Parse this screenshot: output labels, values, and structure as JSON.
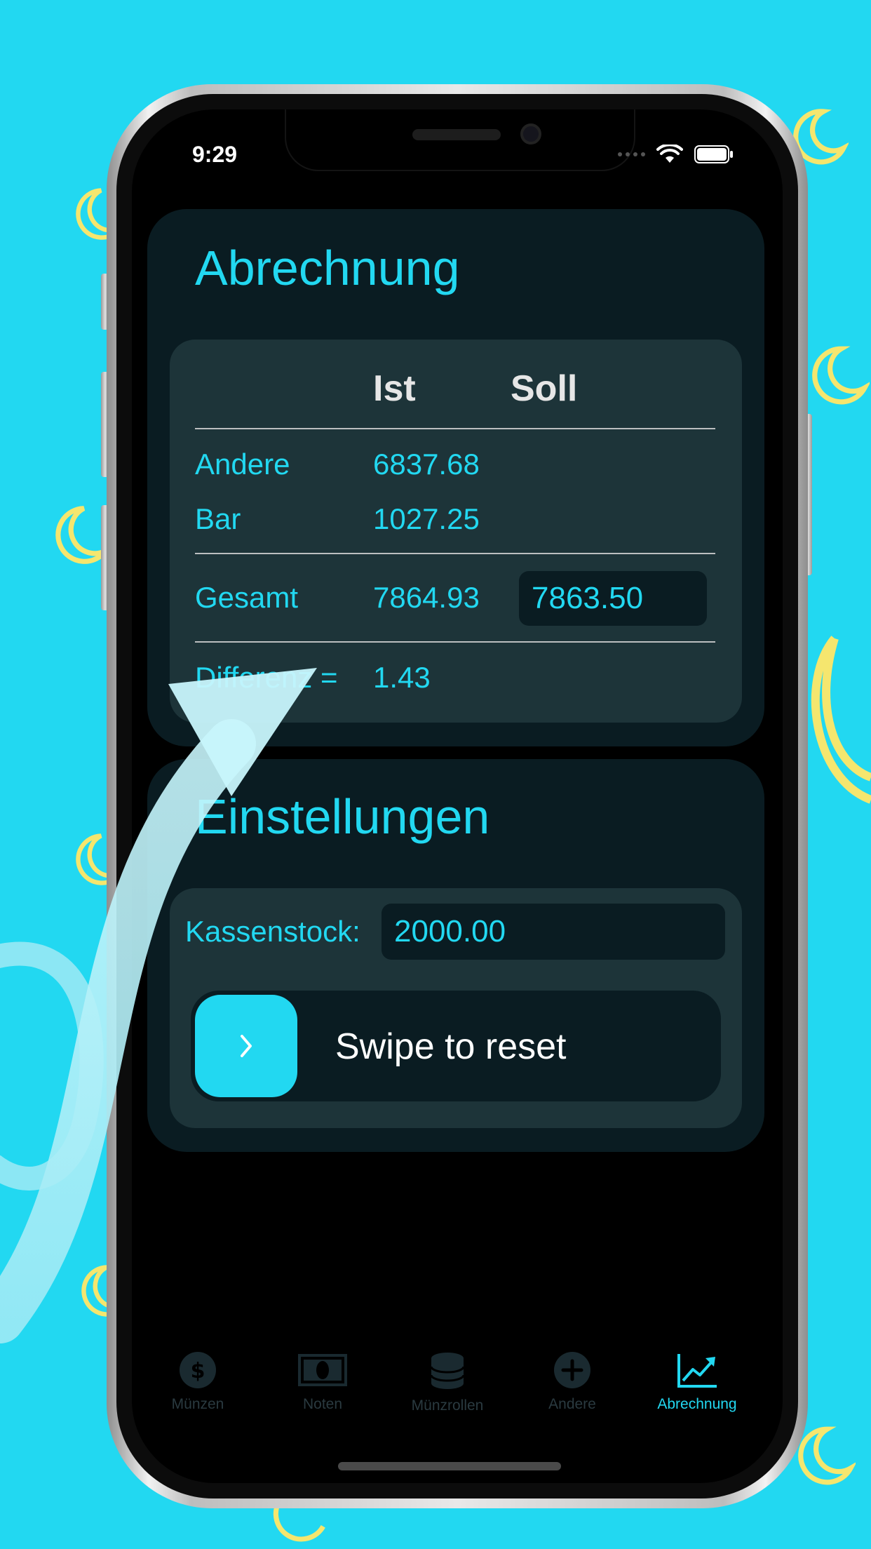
{
  "status_bar": {
    "time": "9:29"
  },
  "abrechnung": {
    "title": "Abrechnung",
    "headers": {
      "ist": "Ist",
      "soll": "Soll"
    },
    "rows": [
      {
        "label": "Andere",
        "ist": "6837.68"
      },
      {
        "label": "Bar",
        "ist": "1027.25"
      }
    ],
    "gesamt": {
      "label": "Gesamt",
      "ist": "7864.93",
      "soll": "7863.50"
    },
    "differenz": {
      "label": "Differenz =",
      "value": "1.43"
    }
  },
  "einstellungen": {
    "title": "Einstellungen",
    "kassenstock_label": "Kassenstock:",
    "kassenstock_value": "2000.00",
    "reset_label": "Swipe to reset"
  },
  "tabs": [
    {
      "label": "Münzen",
      "icon": "dollar-coin-icon"
    },
    {
      "label": "Noten",
      "icon": "banknote-icon"
    },
    {
      "label": "Münzrollen",
      "icon": "coin-stack-icon"
    },
    {
      "label": "Andere",
      "icon": "plus-circle-icon"
    },
    {
      "label": "Abrechnung",
      "icon": "chart-line-icon",
      "active": true
    }
  ],
  "colors": {
    "accent": "#22D8F1",
    "background": "#22D8F1",
    "card": "#0A1C22",
    "inner_card": "#1D3439",
    "moon": "#F5E66E"
  }
}
